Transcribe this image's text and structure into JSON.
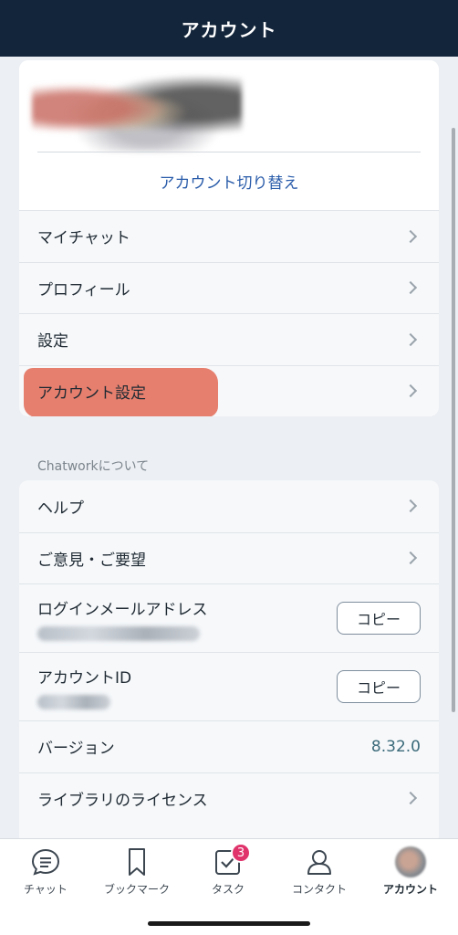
{
  "header": {
    "title": "アカウント"
  },
  "profile": {
    "switch_account": "アカウント切り替え"
  },
  "menu": {
    "my_chat": "マイチャット",
    "profile": "プロフィール",
    "settings": "設定",
    "account_settings": "アカウント設定"
  },
  "about": {
    "section_title": "Chatworkについて",
    "help": "ヘルプ",
    "feedback": "ご意見・ご要望",
    "login_email_label": "ログインメールアドレス",
    "account_id_label": "アカウントID",
    "copy_label": "コピー",
    "version_label": "バージョン",
    "version_value": "8.32.0",
    "licenses": "ライブラリのライセンス"
  },
  "tabbar": {
    "chat": "チャット",
    "bookmark": "ブックマーク",
    "task": "タスク",
    "task_badge": "3",
    "contact": "コンタクト",
    "account": "アカウント"
  },
  "colors": {
    "header_bg": "#13253a",
    "accent_link": "#2a5caa",
    "highlight": "#e57866",
    "badge": "#e0336b"
  },
  "icons": {
    "chat": "chat-bubble-icon",
    "bookmark": "bookmark-icon",
    "task": "task-check-icon",
    "contact": "person-icon",
    "row_arrow": "chevron-right-icon"
  }
}
